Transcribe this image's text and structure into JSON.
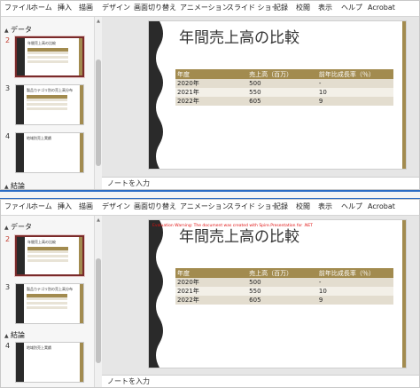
{
  "menu": [
    "ファイル",
    "ホーム",
    "挿入",
    "描画",
    "デザイン",
    "画面切り替え",
    "アニメーション",
    "スライド ショー",
    "記録",
    "校閲",
    "表示",
    "ヘルプ",
    "Acrobat"
  ],
  "sections": {
    "data": "データ",
    "summary": "結論"
  },
  "slide_numbers": [
    "2",
    "3",
    "4"
  ],
  "thumbnails": [
    {
      "title": "年間売上高の比較"
    },
    {
      "title": "製品カテゴリ別の売上高分布"
    },
    {
      "title": "地域別売上実績"
    }
  ],
  "slide": {
    "title": "年間売上高の比較",
    "table": {
      "headers": [
        "年度",
        "売上高（百万）",
        "前年比成長率（％）"
      ],
      "rows": [
        [
          "2020年",
          "500",
          "-"
        ],
        [
          "2021年",
          "550",
          "10"
        ],
        [
          "2022年",
          "605",
          "9"
        ]
      ]
    }
  },
  "watermark": "Evaluation Warning: The document was created with Spire.Presentation for .NET",
  "notes_placeholder": "ノートを入力",
  "colors": {
    "accent": "#a28b4f",
    "selection": "#7a2a2a",
    "divider": "#2b6cc4"
  }
}
